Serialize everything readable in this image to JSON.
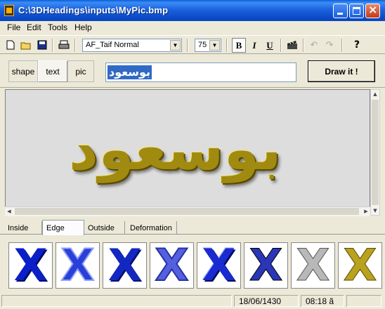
{
  "window": {
    "title": "C:\\3DHeadings\\inputs\\MyPic.bmp"
  },
  "menu": [
    "File",
    "Edit",
    "Tools",
    "Help"
  ],
  "toolbar": {
    "font_name": "AF_Taif Normal",
    "font_size": "75",
    "bold_label": "B",
    "italic_label": "I",
    "underline_label": "U",
    "help_label": "?"
  },
  "modes": {
    "shape": "shape",
    "text": "text",
    "pic": "pic",
    "selected": "text"
  },
  "heading_input": {
    "value": "بوسعود"
  },
  "draw_button": "Draw it !",
  "canvas": {
    "text": "بوسعود"
  },
  "tabs": [
    "Inside",
    "Edge",
    "Outside",
    "Deformation"
  ],
  "active_tab": "Edge",
  "style_tiles": [
    {
      "glyph": "X",
      "color": "#0a1fc8"
    },
    {
      "glyph": "X",
      "color": "#2a3fd8"
    },
    {
      "glyph": "X",
      "color": "#1328c0"
    },
    {
      "glyph": "X",
      "color": "#5360e0"
    },
    {
      "glyph": "X",
      "color": "#1a2ad0"
    },
    {
      "glyph": "X",
      "color": "#2a35b8"
    },
    {
      "glyph": "X",
      "color": "#b8b8b8"
    },
    {
      "glyph": "X",
      "color": "#b9a220"
    }
  ],
  "status": {
    "date": "18/06/1430",
    "time": "08:18 ã"
  },
  "colors": {
    "titlebar": "#0b4cc9",
    "face": "#ece9d8",
    "selection": "#316ac5",
    "heading_gold": "#a08a10"
  }
}
